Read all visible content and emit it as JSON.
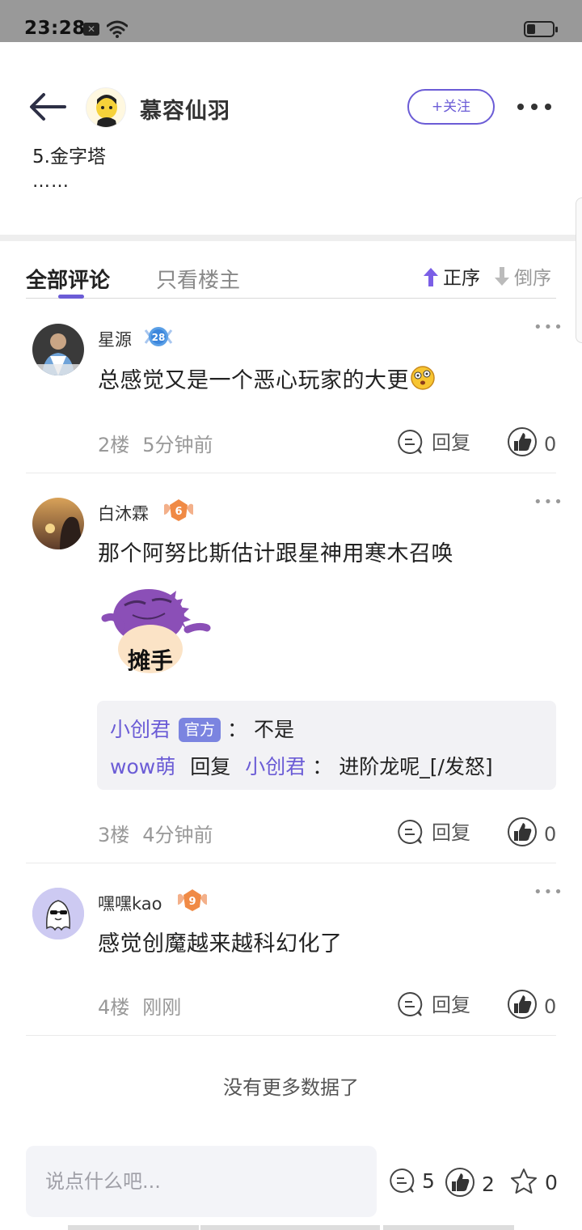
{
  "status_bar": {
    "time": "23:28",
    "notif_icon": "x-icon",
    "wifi_icon": "wifi-icon",
    "battery_icon": "battery-icon"
  },
  "header": {
    "author_name": "慕容仙羽",
    "follow_label": "+关注"
  },
  "post": {
    "clipped_line": "5.金字塔",
    "ellipsis": "……"
  },
  "tabs": {
    "all_label": "全部评论",
    "op_only_label": "只看楼主",
    "sort_asc_label": "正序",
    "sort_desc_label": "倒序"
  },
  "comments": [
    {
      "name": "星源",
      "level": "28",
      "text": "总感觉又是一个恶心玩家的大更",
      "emoji": "dizzy-face-emoji",
      "floor": "2楼",
      "time": "5分钟前",
      "reply_label": "回复",
      "likes": "0"
    },
    {
      "name": "白沐霖",
      "level": "6",
      "text": "那个阿努比斯估计跟星神用寒木召唤",
      "sticker_caption": "摊手",
      "replies": [
        {
          "user": "小创君",
          "tag": "官方",
          "sep": "：",
          "text": "不是"
        },
        {
          "user": "wow萌",
          "action": "回复",
          "target": "小创君",
          "sep": "：",
          "text": "进阶龙呢_[/发怒]"
        }
      ],
      "floor": "3楼",
      "time": "4分钟前",
      "reply_label": "回复",
      "likes": "0"
    },
    {
      "name": "嘿嘿kao",
      "level": "9",
      "text": "感觉创魔越来越科幻化了",
      "floor": "4楼",
      "time": "刚刚",
      "reply_label": "回复",
      "likes": "0"
    }
  ],
  "no_more_text": "没有更多数据了",
  "bottom_bar": {
    "input_placeholder": "说点什么吧...",
    "comment_count": "5",
    "like_count": "2",
    "favorite_count": "0"
  },
  "colors": {
    "accent": "#6b5cd6",
    "status_bar": "#999999",
    "reply_box": "#f2f2f5"
  }
}
